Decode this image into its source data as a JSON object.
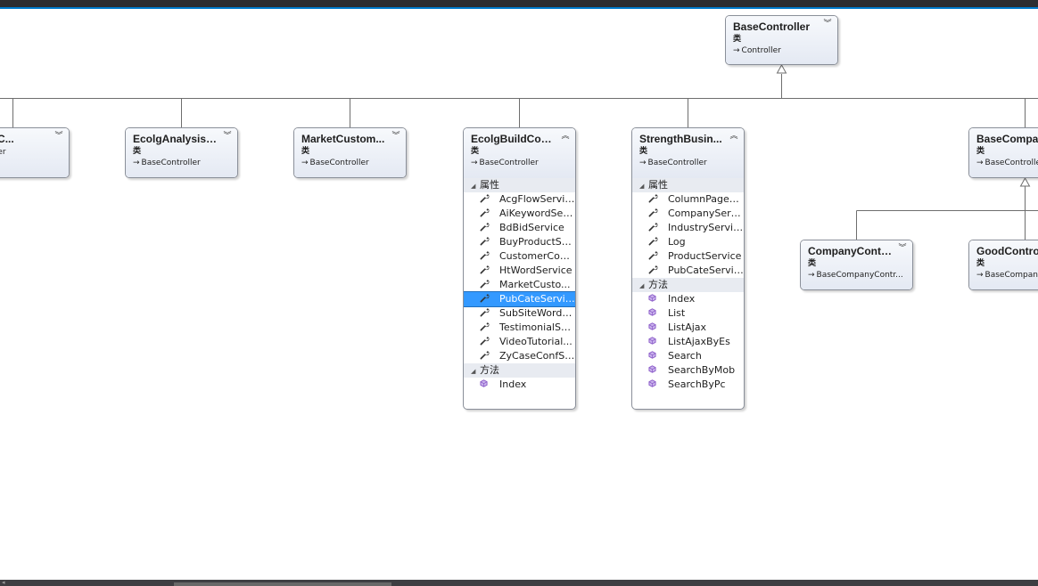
{
  "diagram": {
    "base_root": {
      "name": "BaseController",
      "kind": "类",
      "base": "Controller",
      "expanded": false
    },
    "row1": [
      {
        "id": "news",
        "name": "yNewsC...",
        "kind": "",
        "base": "ontroller",
        "expanded": false
      },
      {
        "id": "analysis",
        "name": "EcolgAnalysisC...",
        "kind": "类",
        "base": "BaseController",
        "expanded": false
      },
      {
        "id": "market",
        "name": "MarketCustom...",
        "kind": "类",
        "base": "BaseController",
        "expanded": false
      },
      {
        "id": "build",
        "name": "EcolgBuildCon...",
        "kind": "类",
        "base": "BaseController",
        "expanded": true,
        "sections": [
          {
            "title": "属性",
            "member_type": "property",
            "members": [
              "AcgFlowService",
              "AiKeywordSer...",
              "BdBidService",
              "BuyProductSe...",
              "CustomerCod...",
              "HtWordService",
              "MarketCusto...",
              "PubCateService",
              "SubSiteWordS...",
              "TestimonialSe...",
              "VideoTutorial...",
              "ZyCaseConfSe..."
            ],
            "selected": "PubCateService"
          },
          {
            "title": "方法",
            "member_type": "method",
            "members": [
              "Index"
            ]
          }
        ]
      },
      {
        "id": "strength",
        "name": "StrengthBusin...",
        "kind": "类",
        "base": "BaseController",
        "expanded": true,
        "sections": [
          {
            "title": "属性",
            "member_type": "property",
            "members": [
              "ColumnPageB...",
              "CompanyServ...",
              "IndustryService",
              "Log",
              "ProductService",
              "PubCateService"
            ]
          },
          {
            "title": "方法",
            "member_type": "method",
            "members": [
              "Index",
              "List",
              "ListAjax",
              "ListAjaxByEs",
              "Search",
              "SearchByMob",
              "SearchByPc"
            ]
          }
        ]
      },
      {
        "id": "basecompany",
        "name": "BaseCompan",
        "kind": "类",
        "base": "BaseControlle",
        "expanded": false
      }
    ],
    "row2": [
      {
        "id": "companyctrl",
        "name": "CompanyContr...",
        "kind": "类",
        "base": "BaseCompanyContr...",
        "expanded": false
      },
      {
        "id": "goodctrl",
        "name": "GoodControl",
        "kind": "类",
        "base": "BaseCompan",
        "expanded": false
      }
    ],
    "icons": {
      "collapsed": "double-chevron-down-icon",
      "expanded": "double-chevron-up-icon",
      "property": "wrench-icon",
      "method": "method-cube-icon",
      "inherits": "inherits-arrow-icon"
    },
    "colors": {
      "header_top": "#f7f9fc",
      "header_bottom": "#e4e9f3",
      "section": "#e8ebf1",
      "selected": "#3399ff",
      "method_icon": "#8a5ac8",
      "line": "#6e6e6e"
    }
  }
}
